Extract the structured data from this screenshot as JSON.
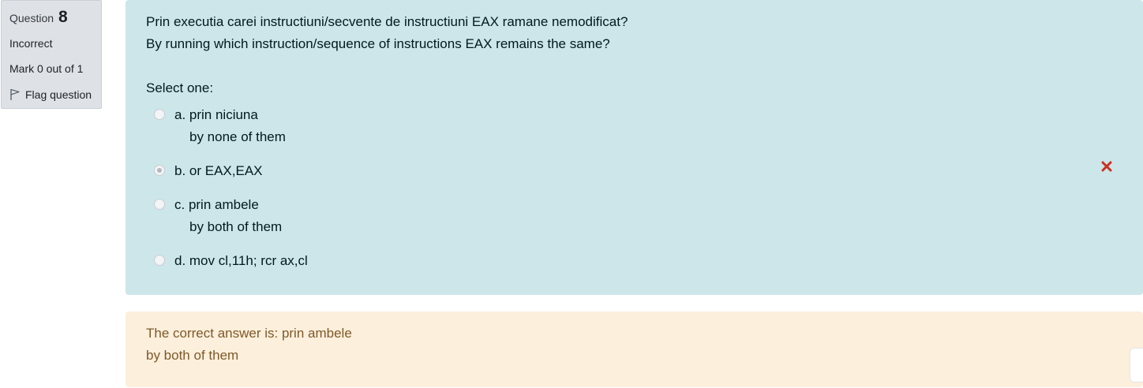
{
  "info": {
    "question_label": "Question",
    "question_number": "8",
    "state": "Incorrect",
    "grade": "Mark 0 out of 1",
    "flag_label": "Flag question",
    "flag_icon": "flag-icon"
  },
  "question": {
    "text_ro": "Prin executia carei instructiuni/secvente de instructiuni EAX ramane nemodificat?",
    "text_en": "By running which instruction/sequence of instructions EAX remains the same?",
    "prompt": "Select one:",
    "options": [
      {
        "line1": "a. prin niciuna",
        "line2": "by none of them",
        "selected": false
      },
      {
        "line1": "b. or EAX,EAX",
        "line2": "",
        "selected": true
      },
      {
        "line1": "c. prin ambele",
        "line2": "by both of them",
        "selected": false
      },
      {
        "line1": "d. mov cl,11h; rcr ax,cl",
        "line2": "",
        "selected": false
      }
    ],
    "incorrect_icon": "close-icon",
    "incorrect_color": "#ca3120"
  },
  "feedback": {
    "line1": "The correct answer is: prin ambele",
    "line2": "by both of them"
  },
  "colors": {
    "formulation_bg": "#cce6ea",
    "feedback_bg": "#fcefdc",
    "info_bg": "#dee2e6"
  }
}
